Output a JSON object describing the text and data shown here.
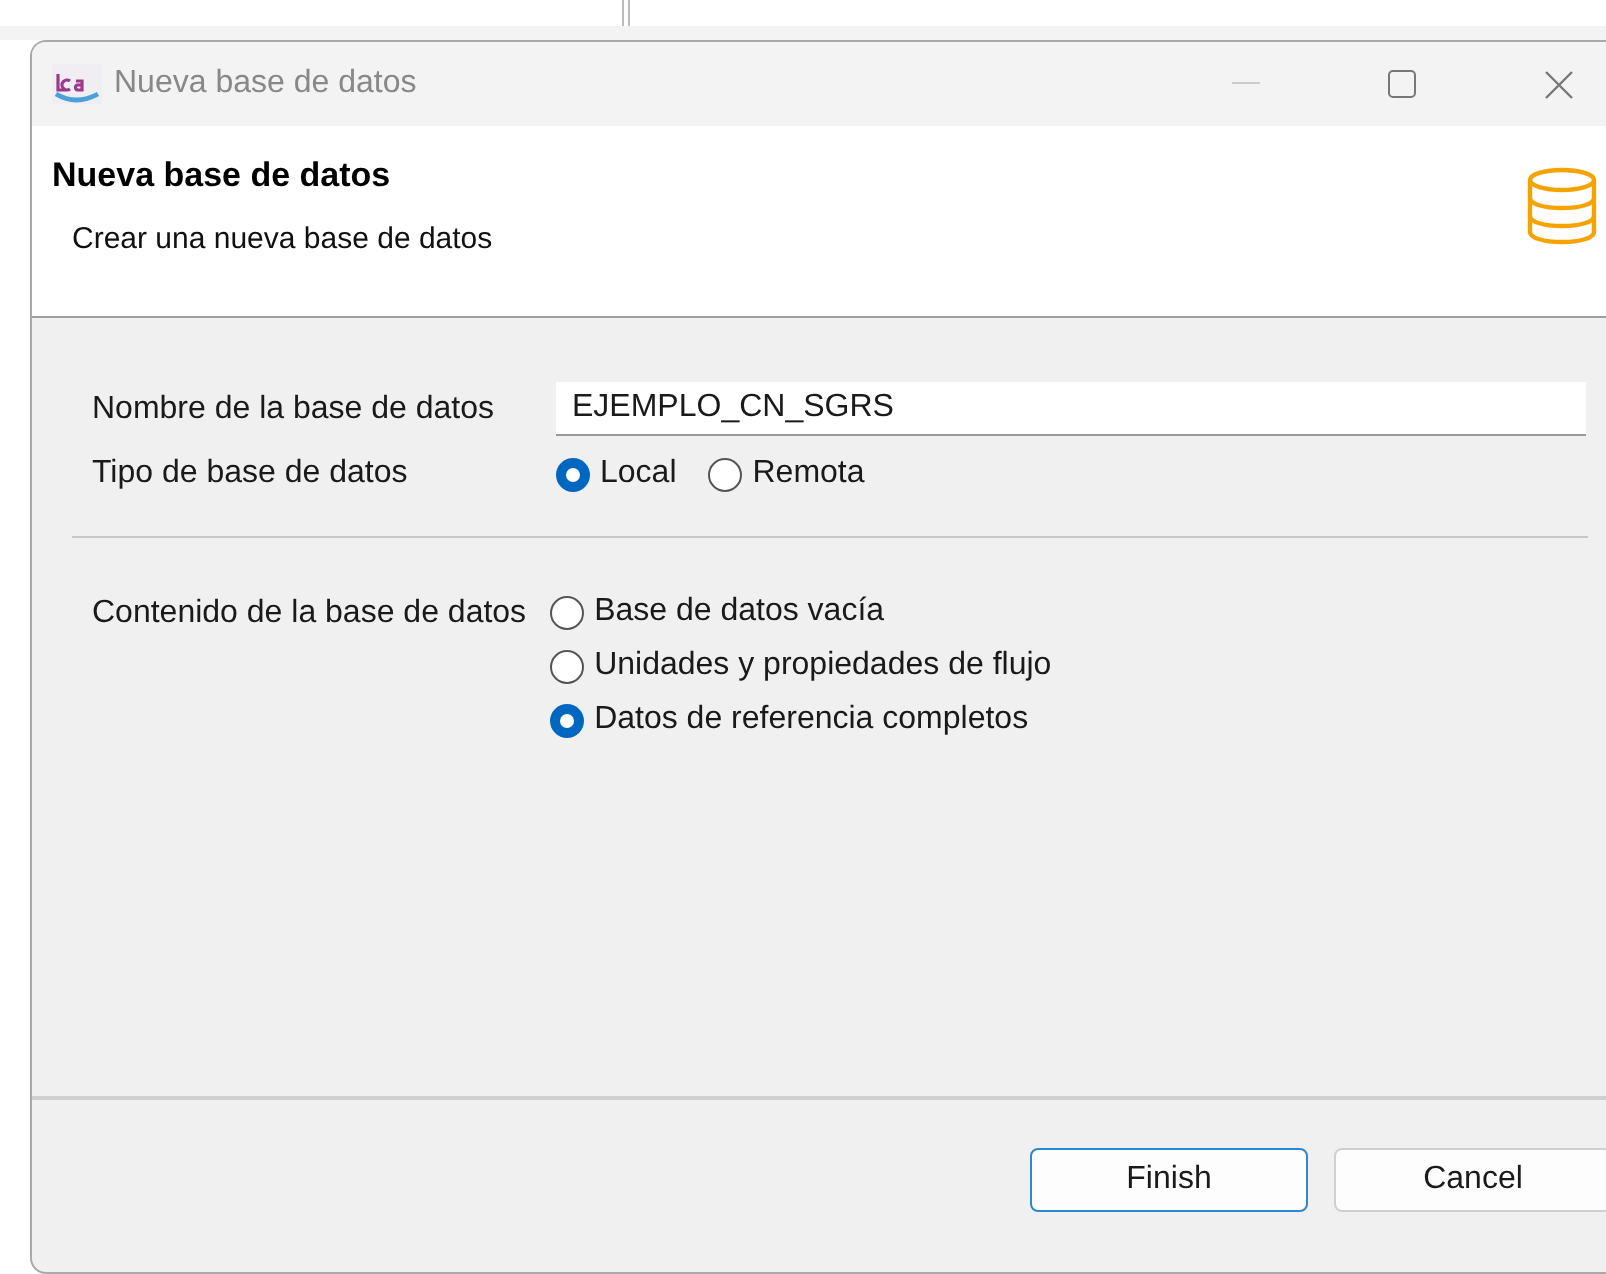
{
  "window": {
    "title": "Nueva base de datos"
  },
  "header": {
    "title": "Nueva base de datos",
    "subtitle": "Crear una nueva base de datos"
  },
  "name_field": {
    "label": "Nombre de la base de datos",
    "value": "EJEMPLO_CN_SGRS"
  },
  "database_type": {
    "label": "Tipo de base de datos",
    "options": [
      {
        "label": "Local",
        "selected": true
      },
      {
        "label": "Remota",
        "selected": false
      }
    ]
  },
  "database_content": {
    "label": "Contenido de la base de datos",
    "options": [
      {
        "label": "Base de datos vacía",
        "selected": false
      },
      {
        "label": "Unidades y propiedades de flujo",
        "selected": false
      },
      {
        "label": "Datos de referencia completos",
        "selected": true
      }
    ]
  },
  "buttons": [
    {
      "label": "Finish",
      "kind": "default"
    },
    {
      "label": "Cancel",
      "kind": "normal"
    }
  ]
}
